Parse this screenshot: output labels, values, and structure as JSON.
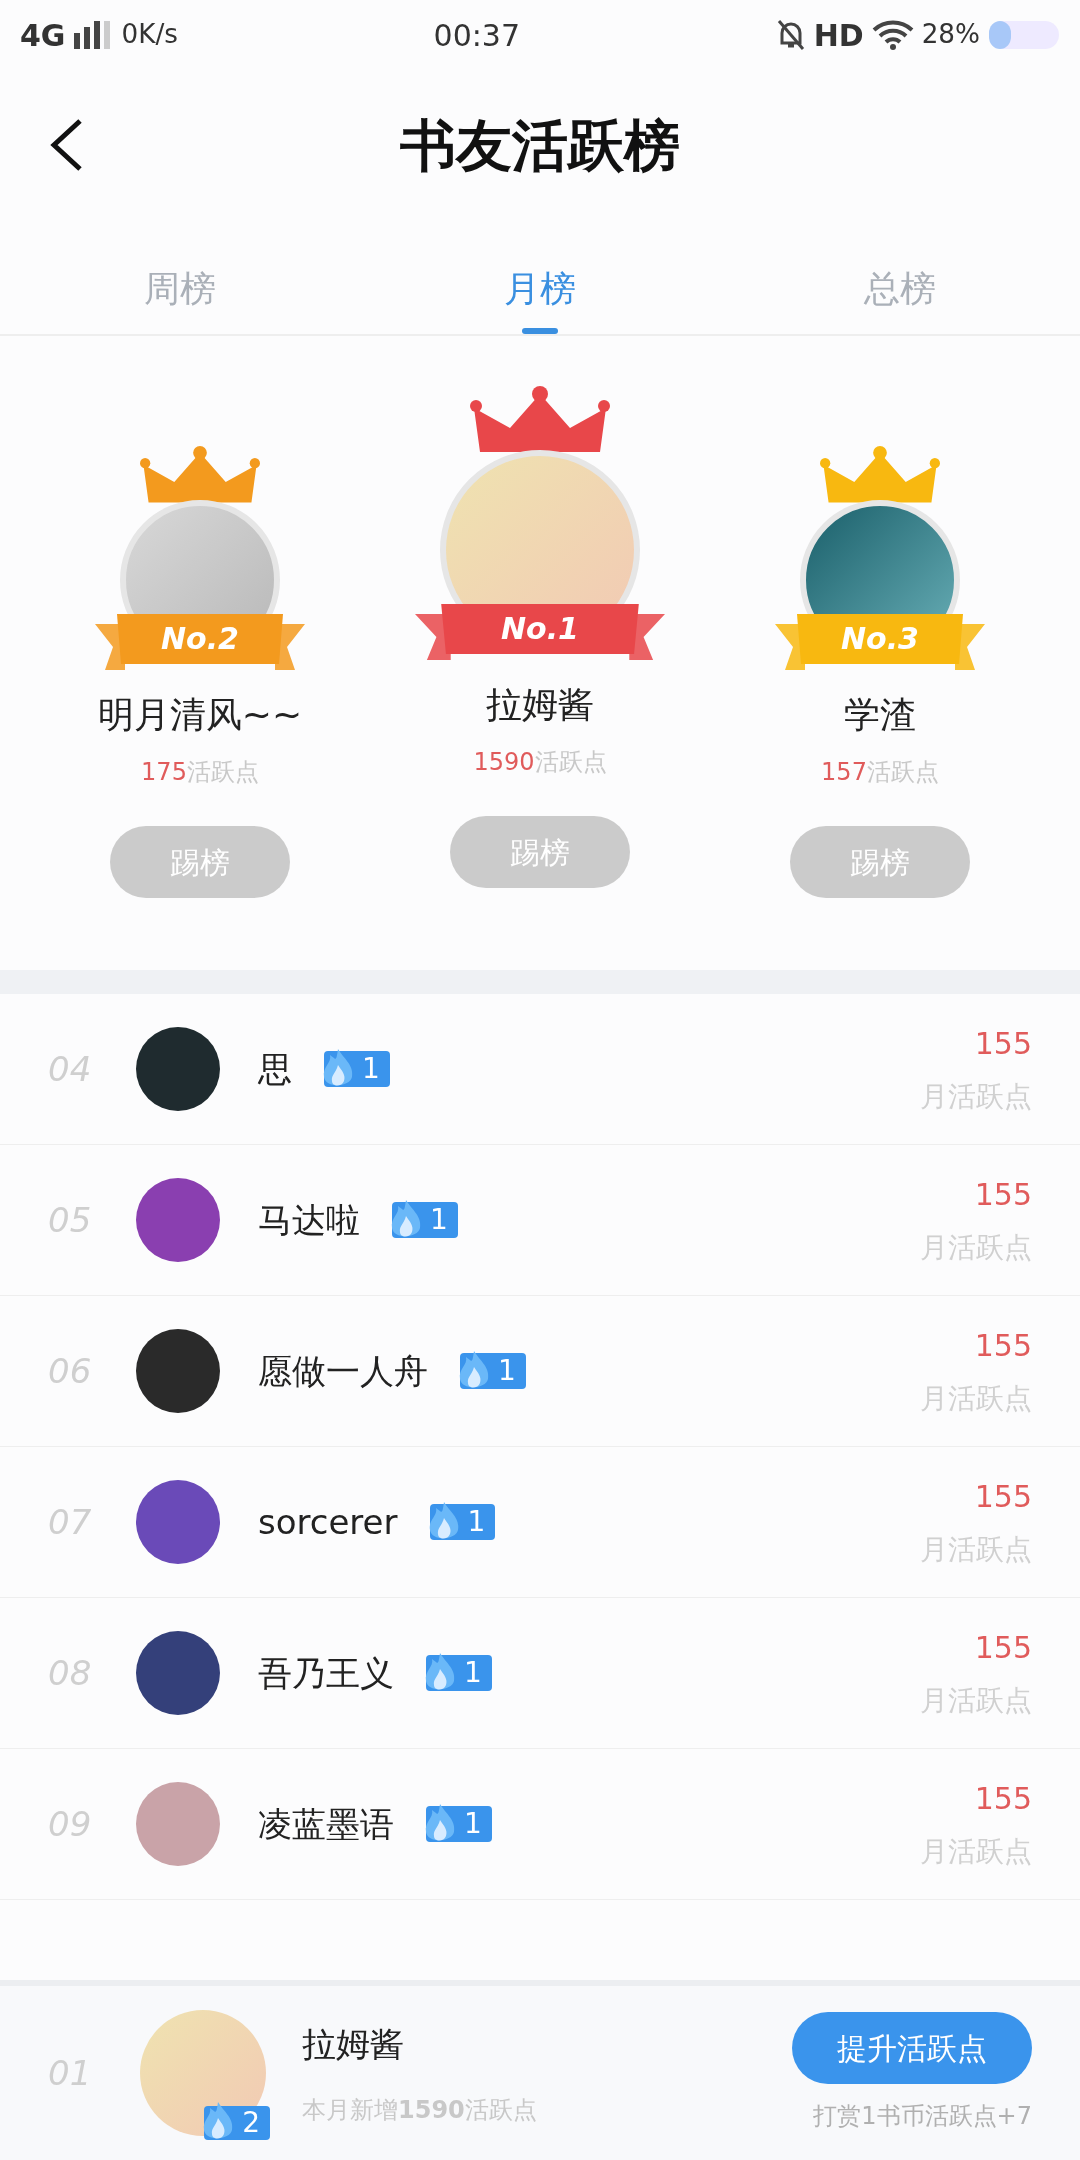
{
  "status_bar": {
    "network": "4G",
    "speed": "0K/s",
    "time": "00:37",
    "hd": "HD",
    "battery": "28%"
  },
  "header": {
    "title": "书友活跃榜"
  },
  "tabs": [
    {
      "label": "周榜",
      "selected": false
    },
    {
      "label": "月榜",
      "selected": true
    },
    {
      "label": "总榜",
      "selected": false
    }
  ],
  "podium": [
    {
      "rank_label": "No.2",
      "name": "明月清风~~",
      "points": "175",
      "points_label": "活跃点",
      "button": "踢榜",
      "color": "#f39a1e",
      "first": false
    },
    {
      "rank_label": "No.1",
      "name": "拉姆酱",
      "points": "1590",
      "points_label": "活跃点",
      "button": "踢榜",
      "color": "#e8474a",
      "first": true
    },
    {
      "rank_label": "No.3",
      "name": "学渣",
      "points": "157",
      "points_label": "活跃点",
      "button": "踢榜",
      "color": "#f8b810",
      "first": false
    }
  ],
  "rows": [
    {
      "rank": "04",
      "name": "思",
      "badge": "1",
      "score": "155",
      "score_label": "月活跃点"
    },
    {
      "rank": "05",
      "name": "马达啦",
      "badge": "1",
      "score": "155",
      "score_label": "月活跃点"
    },
    {
      "rank": "06",
      "name": "愿做一人舟",
      "badge": "1",
      "score": "155",
      "score_label": "月活跃点"
    },
    {
      "rank": "07",
      "name": "sorcerer",
      "badge": "1",
      "score": "155",
      "score_label": "月活跃点"
    },
    {
      "rank": "08",
      "name": "吾乃王义",
      "badge": "1",
      "score": "155",
      "score_label": "月活跃点"
    },
    {
      "rank": "09",
      "name": "凌蓝墨语",
      "badge": "1",
      "score": "155",
      "score_label": "月活跃点"
    }
  ],
  "footer": {
    "rank": "01",
    "name": "拉姆酱",
    "badge": "2",
    "summary": "本月新增**1590**活跃点",
    "button": "提升活跃点",
    "hint": "打赏1书币活跃点+7"
  }
}
